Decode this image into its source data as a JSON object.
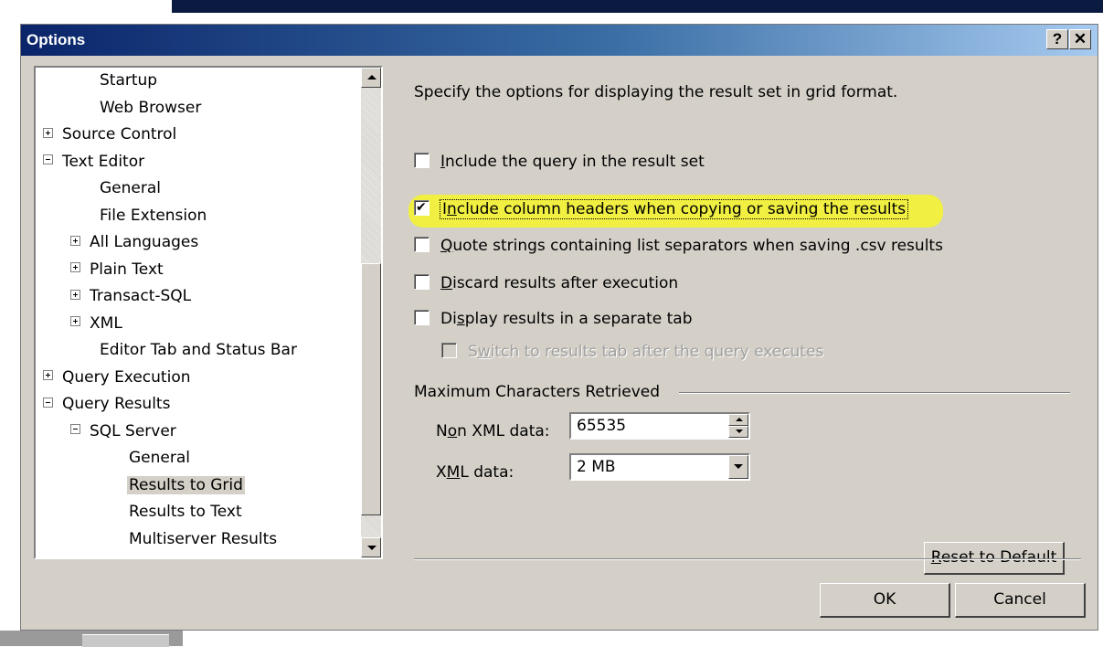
{
  "window": {
    "title": "Options",
    "help_glyph": "?",
    "close_glyph": "✕"
  },
  "tree": {
    "items": [
      {
        "label": "Startup",
        "expander": "none",
        "level": 2
      },
      {
        "label": "Web Browser",
        "expander": "none",
        "level": 2
      },
      {
        "label": "Source Control",
        "expander": "plus",
        "level": 0
      },
      {
        "label": "Text Editor",
        "expander": "minus",
        "level": 0
      },
      {
        "label": "General",
        "expander": "none",
        "level": 2
      },
      {
        "label": "File Extension",
        "expander": "none",
        "level": 2
      },
      {
        "label": "All Languages",
        "expander": "plus",
        "level": 1
      },
      {
        "label": "Plain Text",
        "expander": "plus",
        "level": 1
      },
      {
        "label": "Transact-SQL",
        "expander": "plus",
        "level": 1
      },
      {
        "label": "XML",
        "expander": "plus",
        "level": 1
      },
      {
        "label": "Editor Tab and Status Bar",
        "expander": "none",
        "level": 2
      },
      {
        "label": "Query Execution",
        "expander": "plus",
        "level": 0
      },
      {
        "label": "Query Results",
        "expander": "minus",
        "level": 0
      },
      {
        "label": "SQL Server",
        "expander": "minus",
        "level": 1
      },
      {
        "label": "General",
        "expander": "none",
        "level": 3
      },
      {
        "label": "Results to Grid",
        "expander": "none",
        "level": 3,
        "selected": true
      },
      {
        "label": "Results to Text",
        "expander": "none",
        "level": 3
      },
      {
        "label": "Multiserver Results",
        "expander": "none",
        "level": 3
      }
    ]
  },
  "panel": {
    "description": "Specify the options for displaying the result set in grid format.",
    "options": {
      "include_query": {
        "label": "Include the query in the result set",
        "mnemonic": "I",
        "rest": "nclude the query in the result set",
        "checked": false
      },
      "include_headers": {
        "pre": "I",
        "mnemonic": "n",
        "rest": "clude column headers when copying or saving the results",
        "checked": true,
        "highlight_color": "#f4f42a"
      },
      "quote_strings": {
        "mnemonic": "Q",
        "rest": "uote strings containing list separators when saving .csv results",
        "checked": false
      },
      "discard_results": {
        "mnemonic": "D",
        "rest": "iscard results after execution",
        "checked": false
      },
      "separate_tab": {
        "pre": "Di",
        "mnemonic": "s",
        "rest": "play results in a separate tab",
        "checked": false
      },
      "switch_tab": {
        "pre": "S",
        "mnemonic": "w",
        "rest": "itch to results tab after the query executes",
        "checked": false,
        "enabled": false
      }
    },
    "max_chars": {
      "group_label": "Maximum Characters Retrieved",
      "non_xml_label_pre": "N",
      "non_xml_label_mnemonic": "o",
      "non_xml_label_rest": "n XML data:",
      "non_xml_value": "65535",
      "xml_label_pre": "X",
      "xml_label_mnemonic": "M",
      "xml_label_rest": "L data:",
      "xml_value": "2 MB"
    },
    "reset_mnemonic": "R",
    "reset_rest": "eset to Default"
  },
  "buttons": {
    "ok": "OK",
    "cancel": "Cancel"
  }
}
